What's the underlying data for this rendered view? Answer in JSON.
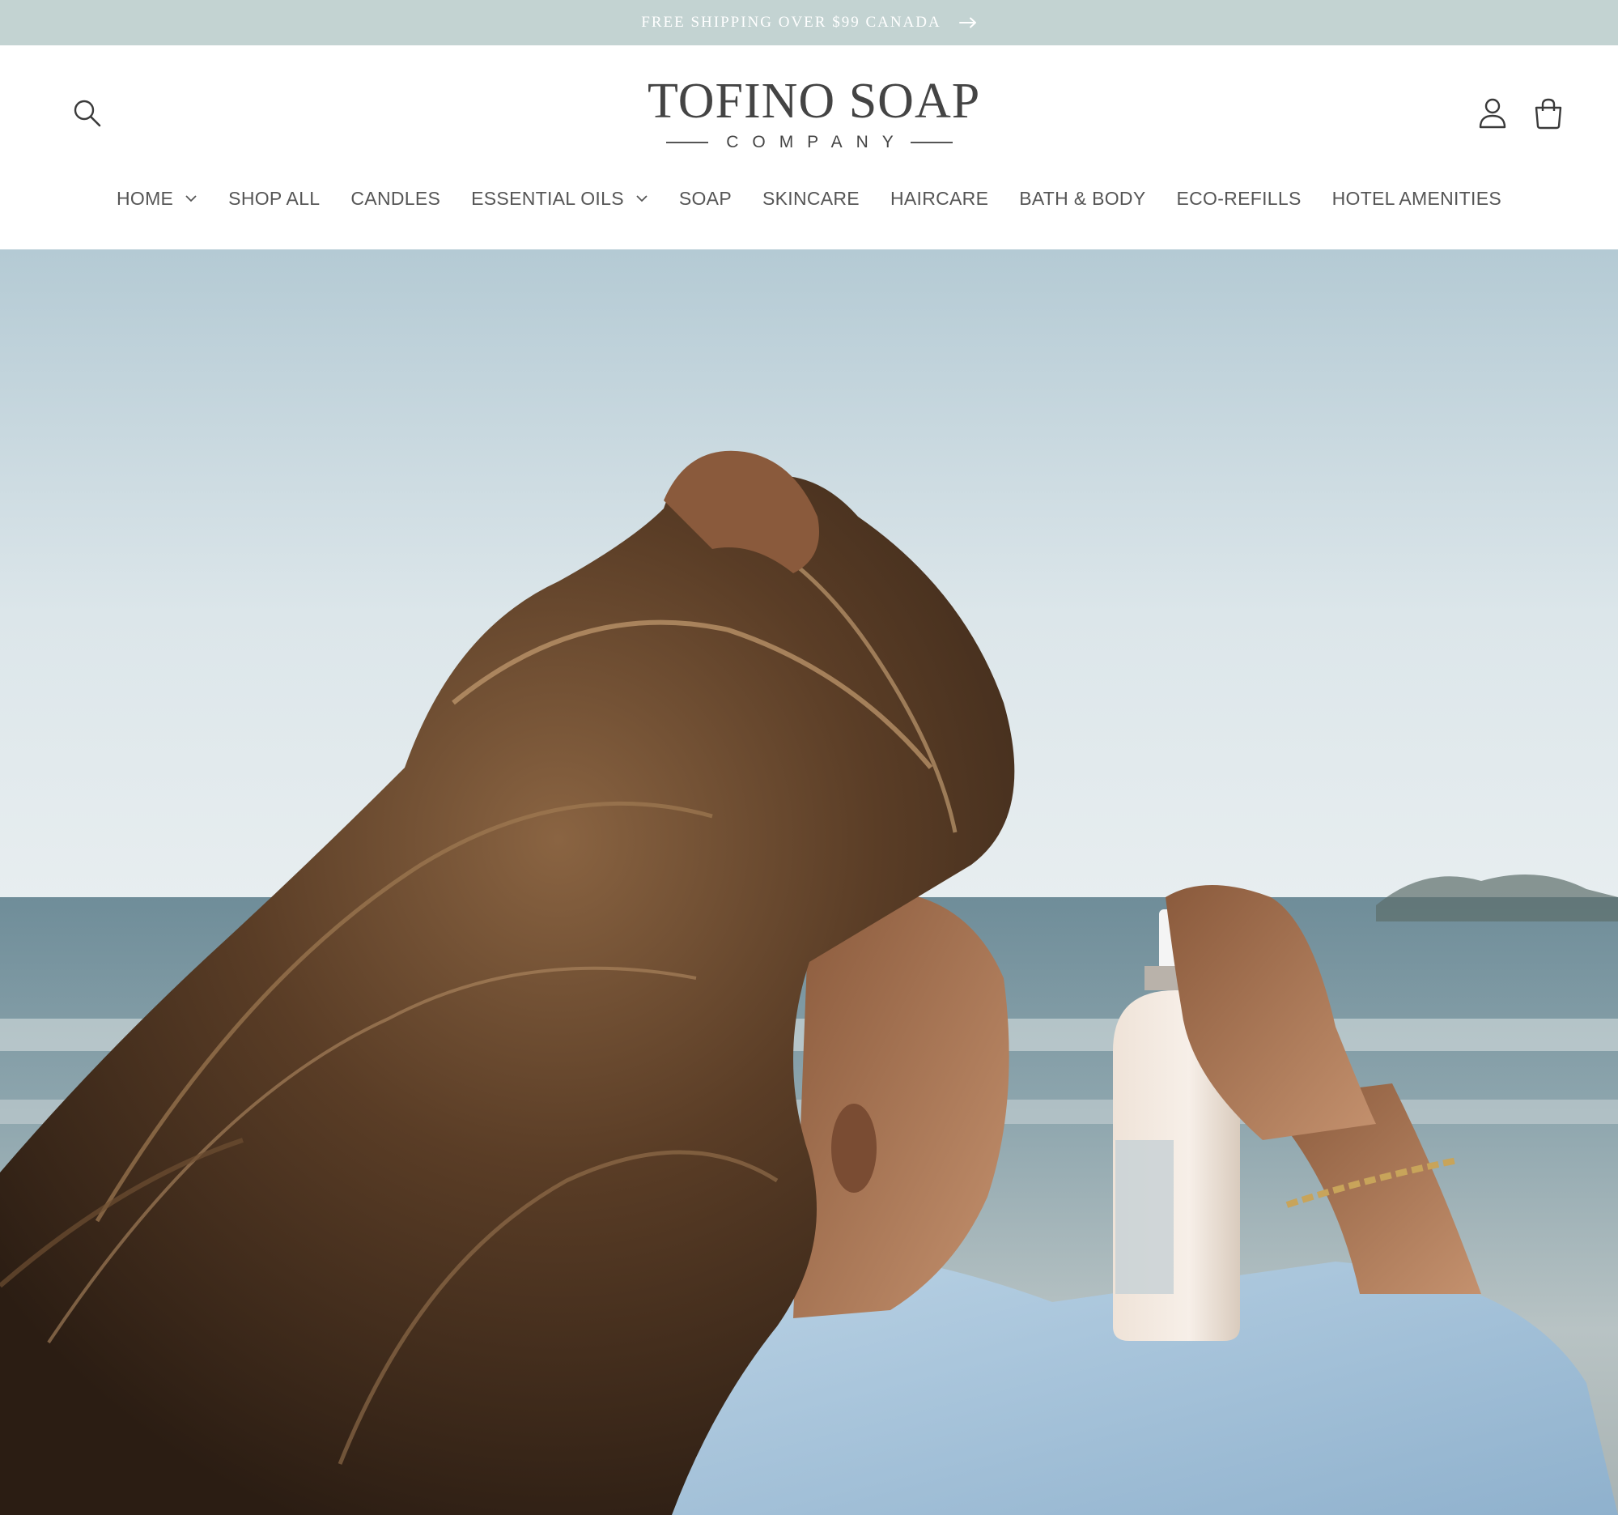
{
  "announcement": {
    "text": "FREE SHIPPING OVER $99 CANADA",
    "icon": "arrow-right-icon"
  },
  "header": {
    "logo": {
      "name": "TOFINO SOAP",
      "subtitle": "COMPANY"
    },
    "icons": {
      "search": "search-icon",
      "account": "account-icon",
      "cart": "cart-icon"
    }
  },
  "nav": {
    "items": [
      {
        "label": "HOME",
        "has_dropdown": true
      },
      {
        "label": "SHOP ALL",
        "has_dropdown": false
      },
      {
        "label": "CANDLES",
        "has_dropdown": false
      },
      {
        "label": "ESSENTIAL OILS",
        "has_dropdown": true
      },
      {
        "label": "SOAP",
        "has_dropdown": false
      },
      {
        "label": "SKINCARE",
        "has_dropdown": false
      },
      {
        "label": "HAIRCARE",
        "has_dropdown": false
      },
      {
        "label": "BATH & BODY",
        "has_dropdown": false
      },
      {
        "label": "ECO-REFILLS",
        "has_dropdown": false
      },
      {
        "label": "HOTEL AMENITIES",
        "has_dropdown": false
      }
    ]
  },
  "colors": {
    "announcement_bg": "#c3d3d2",
    "announcement_text": "#ffffff",
    "nav_text": "#555555",
    "logo_text": "#444444"
  }
}
